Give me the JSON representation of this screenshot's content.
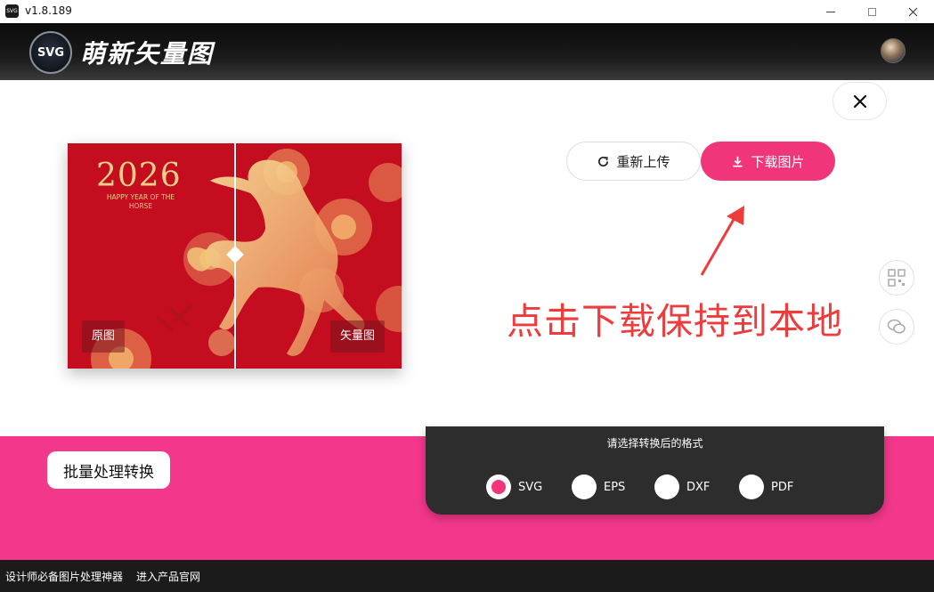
{
  "window": {
    "version": "v1.8.189",
    "app_icon_label": "SVG"
  },
  "header": {
    "logo_label": "SVG",
    "app_name": "萌新矢量图"
  },
  "preview": {
    "year": "2026",
    "greeting": "HAPPY YEAR OF THE HORSE",
    "original_tag": "原图",
    "vector_tag": "矢量图"
  },
  "actions": {
    "reupload_label": "重新上传",
    "download_label": "下载图片"
  },
  "annotation": {
    "text": "点击下载保持到本地"
  },
  "batch": {
    "label": "批量处理转换"
  },
  "format_panel": {
    "title": "请选择转换后的格式",
    "options": [
      {
        "label": "SVG",
        "selected": true
      },
      {
        "label": "EPS",
        "selected": false
      },
      {
        "label": "DXF",
        "selected": false
      },
      {
        "label": "PDF",
        "selected": false
      }
    ]
  },
  "footer": {
    "link1": "设计师必备图片处理神器",
    "link2": "进入产品官网"
  },
  "colors": {
    "accent": "#f0357a",
    "band": "#f3378a",
    "annotation": "#ee3b3b",
    "panel": "#2d2d2d"
  }
}
